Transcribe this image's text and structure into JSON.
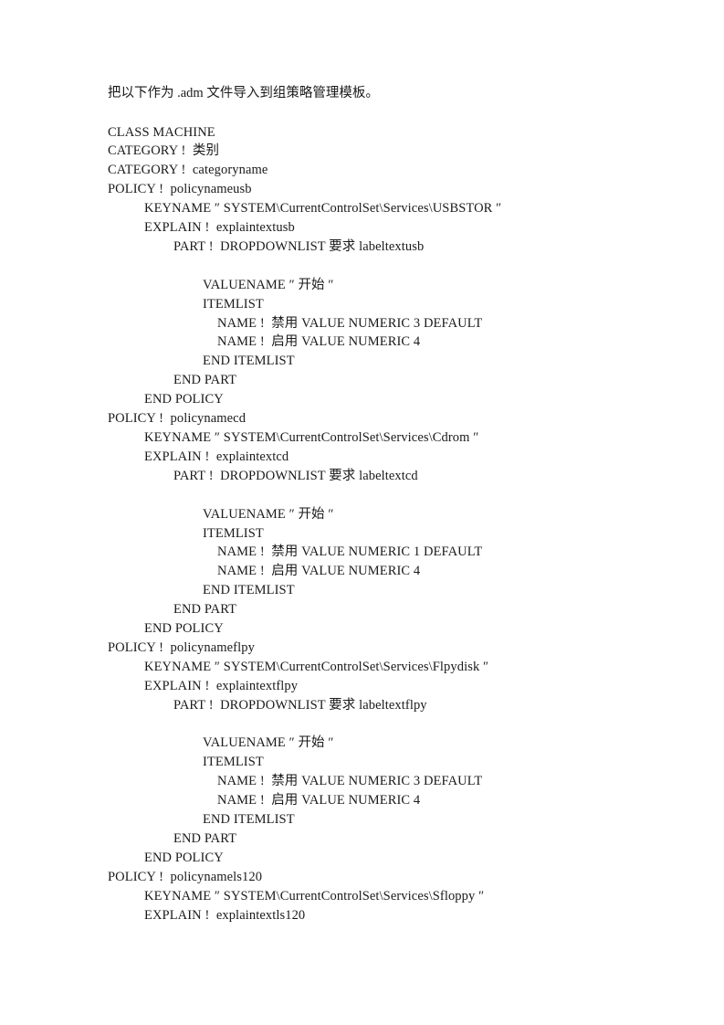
{
  "document": {
    "intro": "把以下作为 .adm 文件导入到组策略管理模板。",
    "lines": [
      {
        "indent": 0,
        "text": "CLASS MACHINE"
      },
      {
        "indent": 0,
        "text": "CATEGORY !  类别"
      },
      {
        "indent": 0,
        "text": "CATEGORY !  categoryname"
      },
      {
        "indent": 0,
        "text": "POLICY !  policynameusb"
      },
      {
        "indent": 1,
        "text": "KEYNAME ″ SYSTEM\\CurrentControlSet\\Services\\USBSTOR ″"
      },
      {
        "indent": 1,
        "text": "EXPLAIN !  explaintextusb"
      },
      {
        "indent": 2,
        "text": "PART !  DROPDOWNLIST 要求 labeltextusb"
      },
      {
        "indent": 0,
        "text": ""
      },
      {
        "indent": 3,
        "text": "VALUENAME ″ 开始 ″"
      },
      {
        "indent": 3,
        "text": "ITEMLIST"
      },
      {
        "indent": 4,
        "text": "NAME !  禁用 VALUE NUMERIC 3 DEFAULT"
      },
      {
        "indent": 4,
        "text": "NAME !  启用 VALUE NUMERIC 4"
      },
      {
        "indent": 3,
        "text": "END ITEMLIST"
      },
      {
        "indent": 2,
        "text": "END PART"
      },
      {
        "indent": 1,
        "text": "END POLICY"
      },
      {
        "indent": 0,
        "text": "POLICY !  policynamecd"
      },
      {
        "indent": 1,
        "text": "KEYNAME ″ SYSTEM\\CurrentControlSet\\Services\\Cdrom ″"
      },
      {
        "indent": 1,
        "text": "EXPLAIN !  explaintextcd"
      },
      {
        "indent": 2,
        "text": "PART !  DROPDOWNLIST 要求 labeltextcd"
      },
      {
        "indent": 0,
        "text": ""
      },
      {
        "indent": 3,
        "text": "VALUENAME ″ 开始 ″"
      },
      {
        "indent": 3,
        "text": "ITEMLIST"
      },
      {
        "indent": 4,
        "text": "NAME !  禁用 VALUE NUMERIC 1 DEFAULT"
      },
      {
        "indent": 4,
        "text": "NAME !  启用 VALUE NUMERIC 4"
      },
      {
        "indent": 3,
        "text": "END ITEMLIST"
      },
      {
        "indent": 2,
        "text": "END PART"
      },
      {
        "indent": 1,
        "text": "END POLICY"
      },
      {
        "indent": 0,
        "text": "POLICY !  policynameflpy"
      },
      {
        "indent": 1,
        "text": "KEYNAME ″ SYSTEM\\CurrentControlSet\\Services\\Flpydisk ″"
      },
      {
        "indent": 1,
        "text": "EXPLAIN !  explaintextflpy"
      },
      {
        "indent": 2,
        "text": "PART !  DROPDOWNLIST 要求 labeltextflpy"
      },
      {
        "indent": 0,
        "text": ""
      },
      {
        "indent": 3,
        "text": "VALUENAME ″ 开始 ″"
      },
      {
        "indent": 3,
        "text": "ITEMLIST"
      },
      {
        "indent": 4,
        "text": "NAME !  禁用 VALUE NUMERIC 3 DEFAULT"
      },
      {
        "indent": 4,
        "text": "NAME !  启用 VALUE NUMERIC 4"
      },
      {
        "indent": 3,
        "text": "END ITEMLIST"
      },
      {
        "indent": 2,
        "text": "END PART"
      },
      {
        "indent": 1,
        "text": "END POLICY"
      },
      {
        "indent": 0,
        "text": "POLICY !  policynamels120"
      },
      {
        "indent": 1,
        "text": "KEYNAME ″ SYSTEM\\CurrentControlSet\\Services\\Sfloppy ″"
      },
      {
        "indent": 1,
        "text": "EXPLAIN !  explaintextls120"
      }
    ]
  }
}
